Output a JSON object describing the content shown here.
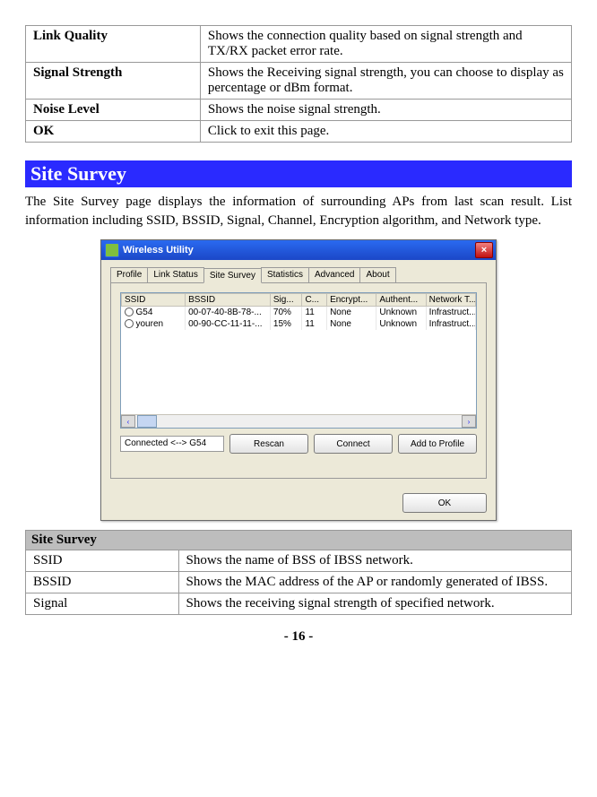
{
  "top_table": [
    {
      "key": "Link Quality",
      "desc": "Shows the connection quality based on signal strength and TX/RX packet error rate."
    },
    {
      "key": "Signal Strength",
      "desc": "Shows the Receiving signal strength, you can choose to display as percentage or dBm format."
    },
    {
      "key": "Noise Level",
      "desc": "Shows the noise signal strength."
    },
    {
      "key": "OK",
      "desc": "Click to exit this page."
    }
  ],
  "section": {
    "title": "Site Survey",
    "body": "The Site Survey page displays the information of surrounding APs from last scan result. List information including SSID, BSSID, Signal, Channel, Encryption algorithm, and Network type."
  },
  "window": {
    "title": "Wireless Utility",
    "tabs": [
      "Profile",
      "Link Status",
      "Site Survey",
      "Statistics",
      "Advanced",
      "About"
    ],
    "active_tab": 2,
    "columns": [
      "SSID",
      "BSSID",
      "Sig...",
      "C...",
      "Encrypt...",
      "Authent...",
      "Network T..."
    ],
    "rows": [
      {
        "ssid": "G54",
        "bssid": "00-07-40-8B-78-...",
        "sig": "70%",
        "ch": "11",
        "enc": "None",
        "auth": "Unknown",
        "net": "Infrastruct..."
      },
      {
        "ssid": "youren",
        "bssid": "00-90-CC-11-11-...",
        "sig": "15%",
        "ch": "11",
        "enc": "None",
        "auth": "Unknown",
        "net": "Infrastruct..."
      }
    ],
    "status": "Connected <--> G54",
    "buttons": {
      "rescan": "Rescan",
      "connect": "Connect",
      "add": "Add to Profile",
      "ok": "OK"
    }
  },
  "bottom_table": {
    "header": "Site Survey",
    "rows": [
      {
        "key": "SSID",
        "desc": "Shows the name of BSS of IBSS network."
      },
      {
        "key": "BSSID",
        "desc": "Shows the MAC address of the AP or randomly generated of IBSS."
      },
      {
        "key": "Signal",
        "desc": "Shows the receiving signal strength of specified network."
      }
    ]
  },
  "page_number": "- 16 -"
}
